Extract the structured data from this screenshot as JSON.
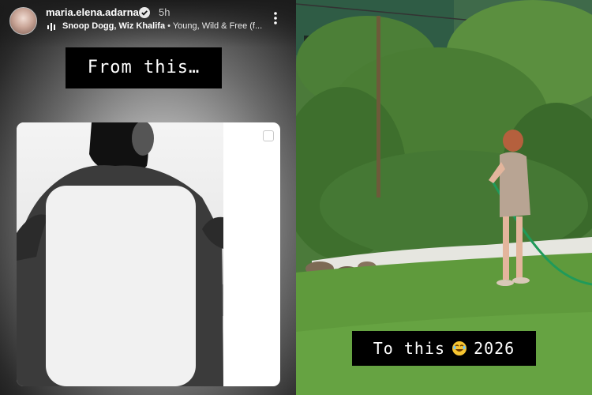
{
  "story": {
    "username": "maria.elena.adarna",
    "time_ago": "5h",
    "music_artists": "Snoop Dogg, Wiz Khalifa",
    "music_song": " • Young, Wild & Free (f...",
    "caption_top": "From this…",
    "caption_bottom_text1": "To this",
    "caption_bottom_emoji": "🤣",
    "caption_bottom_text2": "2026"
  },
  "icons": {
    "verified": "verified-badge-icon",
    "music": "music-bars-icon",
    "more": "more-vertical-icon",
    "select": "select-checkbox-icon",
    "emoji": "rolling-on-floor-laughing-emoji"
  },
  "colors": {
    "verified_blue": "#3897f0",
    "caption_bg": "#000000",
    "grass_green": "#5f9a3c"
  }
}
